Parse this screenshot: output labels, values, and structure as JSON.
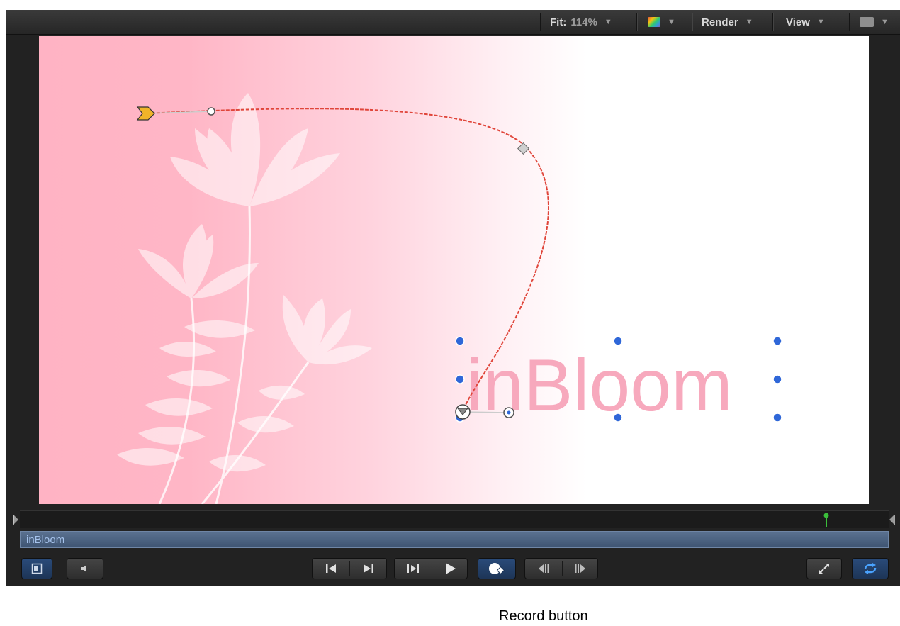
{
  "toolbar": {
    "fit_label": "Fit:",
    "fit_value": "114%",
    "render_label": "Render",
    "view_label": "View"
  },
  "canvas": {
    "text_object": "inBloom",
    "text_color": "#f7a9bd",
    "path_color": "#e0453a",
    "handle_color": "#2f67d8",
    "start_marker_color": "#f0b429"
  },
  "timeline": {
    "clip_name": "inBloom",
    "playhead_color": "#3bbf3b"
  },
  "transport": {
    "buttons": [
      "play-range-toggle-icon",
      "audio-icon",
      "go-to-start-icon",
      "go-to-end-icon",
      "play-from-start-icon",
      "play-icon",
      "record-icon",
      "previous-frame-icon",
      "next-frame-icon",
      "fullscreen-icon",
      "loop-icon"
    ]
  },
  "callout": {
    "label": "Record button"
  }
}
